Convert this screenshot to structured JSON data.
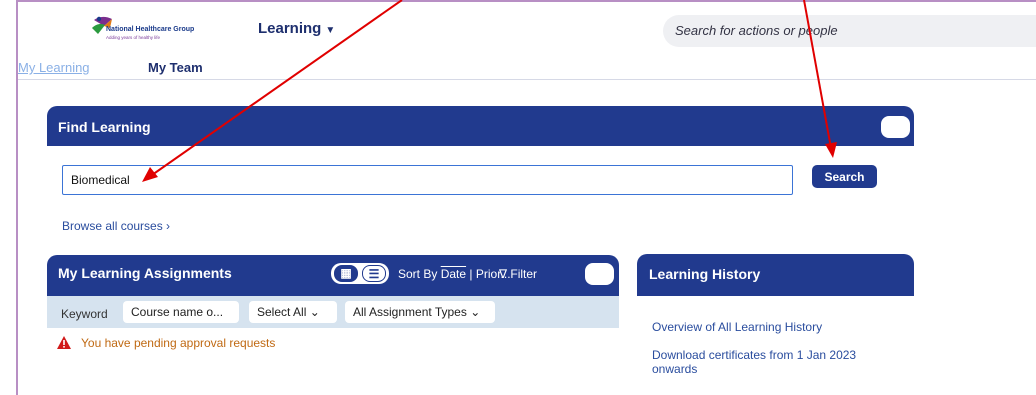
{
  "header": {
    "logo": {
      "name": "National Healthcare Group",
      "tagline": "Adding years of healthy life"
    },
    "learning_menu": "Learning",
    "search_placeholder": "Search for actions or people"
  },
  "tabs": [
    {
      "label": "My Learning",
      "active": false
    },
    {
      "label": "My Team",
      "active": true
    }
  ],
  "find_learning": {
    "title": "Find Learning",
    "keyword_value": "Biomedical",
    "search_label": "Search",
    "browse_label": "Browse all courses ›"
  },
  "assignments": {
    "title": "My Learning Assignments",
    "sort_prefix": "Sort By",
    "sort_date": "Date",
    "sort_rest": " | Prior...",
    "filter_label": "Filter",
    "keyword_label": "Keyword",
    "course_placeholder": "Course name o...",
    "select_all": "Select All",
    "assignment_types": "All Assignment Types",
    "pending_message": "You have pending approval requests"
  },
  "history": {
    "title": "Learning History",
    "links": [
      "Overview of All Learning History",
      "Download certificates from 1 Jan 2023 onwards"
    ]
  },
  "colors": {
    "header_blue": "#213a8e",
    "link_blue": "#2a4d9e",
    "warning_orange": "#c06a14",
    "annotation_red": "#e00000"
  }
}
